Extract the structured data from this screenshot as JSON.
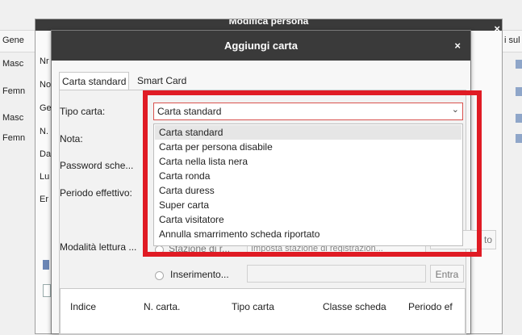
{
  "background_window": {
    "header": {
      "col1": "Gene",
      "col_right": "i sul"
    },
    "rows": [
      {
        "gender": "Masc"
      },
      {
        "gender": "Femn"
      },
      {
        "gender": "Masc"
      },
      {
        "gender": "Femn"
      }
    ]
  },
  "edit_person_window": {
    "title": "Modifica persona",
    "close_label": "×",
    "labels": [
      "Nr",
      "No",
      "Ge",
      "N.",
      "Da",
      "Lu",
      "Er"
    ]
  },
  "add_card_dialog": {
    "title": "Aggiungi carta",
    "close_label": "×",
    "tabs": {
      "standard": "Carta standard",
      "smart": "Smart Card"
    },
    "fields": {
      "card_type_label": "Tipo carta:",
      "note_label": "Nota:",
      "password_label": "Password sche...",
      "period_label": "Periodo effettivo:",
      "read_mode_label": "Modalità lettura ..."
    },
    "card_type_select": {
      "value": "Carta standard",
      "options": [
        "Carta standard",
        "Carta per persona disabile",
        "Carta nella lista nera",
        "Carta ronda",
        "Carta duress",
        "Super carta",
        "Carta visitatore",
        "Annulla smarrimento scheda riportato"
      ]
    },
    "read_mode": {
      "option1_label": "Stazione di r...",
      "station_field": "Imposta stazione di registrazion...",
      "right_button_partial": "to",
      "option2_label": "Inserimento...",
      "enter_button": "Entra"
    },
    "table_headers": [
      "Indice",
      "N. carta.",
      "Tipo carta",
      "Classe scheda",
      "Periodo ef"
    ]
  },
  "colors": {
    "highlight": "#e01b24",
    "title_bar": "#3a3a3a"
  }
}
